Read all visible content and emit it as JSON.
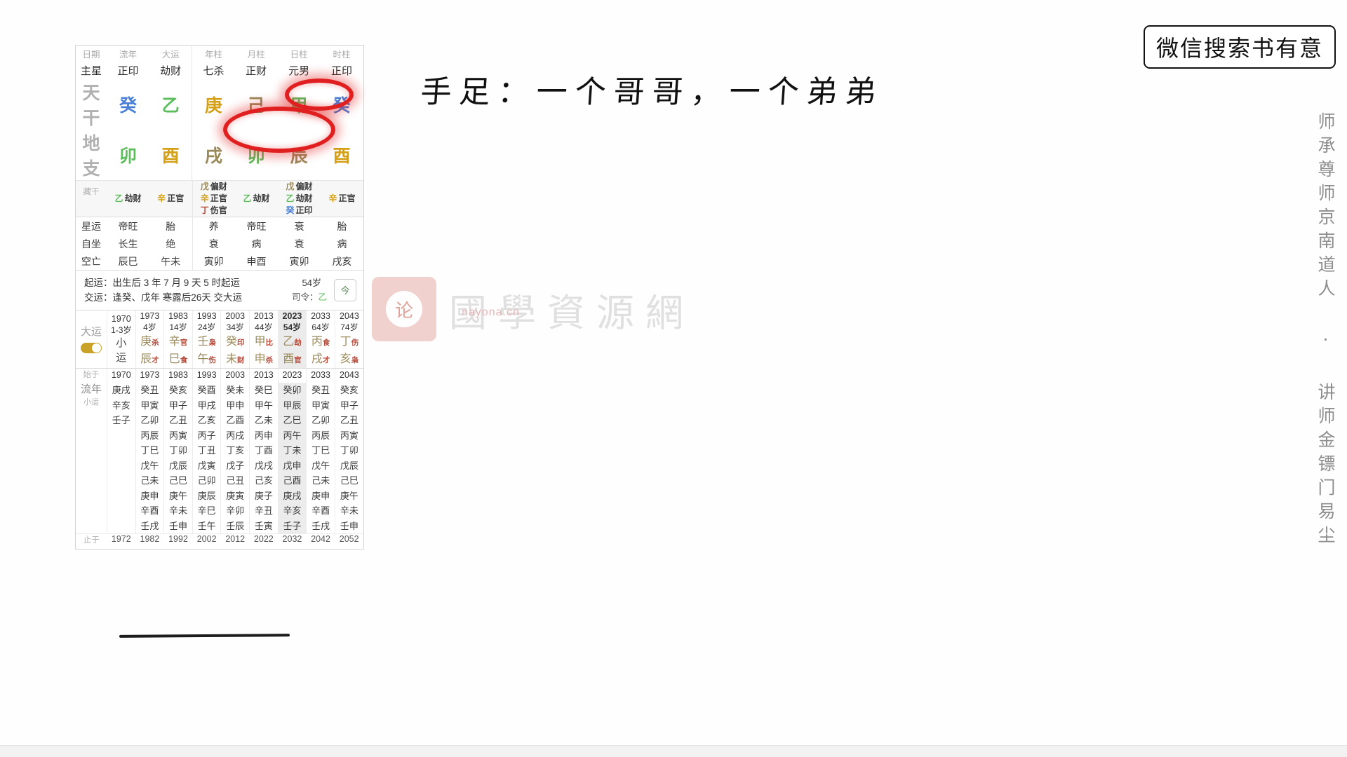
{
  "wechat_box": {
    "text": "微信搜索书有意"
  },
  "side_vertical": {
    "text": "师承尊师京南道人 · 讲师金镖门易尘"
  },
  "handwriting": {
    "text": "手足：一个哥哥，一个弟弟"
  },
  "watermark": {
    "seal_char": "论",
    "text": "國學資源網",
    "url": "nayona.cn"
  },
  "bazi": {
    "row_labels": {
      "date": "日期",
      "zhuxing": "主星",
      "tiangan": "天干",
      "dizhi": "地支",
      "canggan": "藏干",
      "xingyun": "星运",
      "zizuo": "自坐",
      "kongwang": "空亡"
    },
    "columns": [
      {
        "head": "流年",
        "zhuxing": "正印",
        "gan": "癸",
        "gan_color": "water",
        "zhi": "卯",
        "zhi_color": "wood",
        "canggan": [
          {
            "g": "乙",
            "gc": "wood",
            "t": "劫财"
          }
        ],
        "xingyun": "帝旺",
        "zizuo": "长生",
        "kongwang": "辰巳"
      },
      {
        "head": "大运",
        "zhuxing": "劫财",
        "gan": "乙",
        "gan_color": "wood",
        "zhi": "酉",
        "zhi_color": "metal",
        "canggan": [
          {
            "g": "辛",
            "gc": "metal",
            "t": "正官"
          }
        ],
        "xingyun": "胎",
        "zizuo": "绝",
        "kongwang": "午未"
      },
      {
        "head": "年柱",
        "zhuxing": "七杀",
        "gan": "庚",
        "gan_color": "metal",
        "zhi": "戌",
        "zhi_color": "earth",
        "canggan": [
          {
            "g": "戊",
            "gc": "earth",
            "t": "偏财"
          },
          {
            "g": "辛",
            "gc": "metal",
            "t": "正官"
          },
          {
            "g": "丁",
            "gc": "fire",
            "t": "伤官"
          }
        ],
        "xingyun": "养",
        "zizuo": "衰",
        "kongwang": "寅卯"
      },
      {
        "head": "月柱",
        "zhuxing": "正财",
        "gan": "己",
        "gan_color": "earth",
        "zhi": "卯",
        "zhi_color": "wood",
        "canggan": [
          {
            "g": "乙",
            "gc": "wood",
            "t": "劫财"
          }
        ],
        "xingyun": "帝旺",
        "zizuo": "病",
        "kongwang": "申酉"
      },
      {
        "head": "日柱",
        "zhuxing": "元男",
        "gan": "甲",
        "gan_color": "wood",
        "zhi": "辰",
        "zhi_color": "earth",
        "canggan": [
          {
            "g": "戊",
            "gc": "earth",
            "t": "偏财"
          },
          {
            "g": "乙",
            "gc": "wood",
            "t": "劫财"
          },
          {
            "g": "癸",
            "gc": "water",
            "t": "正印"
          }
        ],
        "xingyun": "衰",
        "zizuo": "衰",
        "kongwang": "寅卯"
      },
      {
        "head": "时柱",
        "zhuxing": "正印",
        "gan": "癸",
        "gan_color": "water",
        "zhi": "酉",
        "zhi_color": "metal",
        "canggan": [
          {
            "g": "辛",
            "gc": "metal",
            "t": "正官"
          }
        ],
        "xingyun": "胎",
        "zizuo": "病",
        "kongwang": "戌亥"
      }
    ],
    "qiyun": {
      "line1": "起运：出生后 3 年 7 月 9 天 5 时起运",
      "line2": "交运：逢癸、戊年 寒露后26天 交大运",
      "age_badge": "54岁",
      "siling_label": "司令：",
      "siling_value": "乙",
      "today_btn": "今"
    },
    "dayun": {
      "label": "大运",
      "xiaoyun_label": "小运",
      "items": [
        {
          "year": "1970",
          "age": "1-3岁",
          "gan": "",
          "gan_color": "",
          "gan_ss": "",
          "zhi": "",
          "zhi_color": "",
          "zhi_ss": "",
          "xiaoyun": true,
          "selected": false
        },
        {
          "year": "1973",
          "age": "4岁",
          "gan": "庚",
          "gan_color": "earth",
          "gan_ss": "杀",
          "zhi": "辰",
          "zhi_color": "earth",
          "zhi_ss": "才",
          "xiaoyun": false,
          "selected": false
        },
        {
          "year": "1983",
          "age": "14岁",
          "gan": "辛",
          "gan_color": "earth",
          "gan_ss": "官",
          "zhi": "巳",
          "zhi_color": "earth",
          "zhi_ss": "食",
          "xiaoyun": false,
          "selected": false
        },
        {
          "year": "1993",
          "age": "24岁",
          "gan": "壬",
          "gan_color": "earth",
          "gan_ss": "枭",
          "zhi": "午",
          "zhi_color": "earth",
          "zhi_ss": "伤",
          "xiaoyun": false,
          "selected": false
        },
        {
          "year": "2003",
          "age": "34岁",
          "gan": "癸",
          "gan_color": "earth",
          "gan_ss": "印",
          "zhi": "未",
          "zhi_color": "earth",
          "zhi_ss": "财",
          "xiaoyun": false,
          "selected": false
        },
        {
          "year": "2013",
          "age": "44岁",
          "gan": "甲",
          "gan_color": "earth",
          "gan_ss": "比",
          "zhi": "申",
          "zhi_color": "earth",
          "zhi_ss": "杀",
          "xiaoyun": false,
          "selected": false
        },
        {
          "year": "2023",
          "age": "54岁",
          "gan": "乙",
          "gan_color": "earth",
          "gan_ss": "劫",
          "zhi": "酉",
          "zhi_color": "earth",
          "zhi_ss": "官",
          "xiaoyun": false,
          "selected": true
        },
        {
          "year": "2033",
          "age": "64岁",
          "gan": "丙",
          "gan_color": "earth",
          "gan_ss": "食",
          "zhi": "戌",
          "zhi_color": "earth",
          "zhi_ss": "才",
          "xiaoyun": false,
          "selected": false
        },
        {
          "year": "2043",
          "age": "74岁",
          "gan": "丁",
          "gan_color": "earth",
          "gan_ss": "伤",
          "zhi": "亥",
          "zhi_color": "earth",
          "zhi_ss": "枭",
          "xiaoyun": false,
          "selected": false
        }
      ]
    },
    "liunian": {
      "start_label": "始于",
      "end_label": "止于",
      "side_big": "流年",
      "side_small": "小运",
      "columns": [
        {
          "start": "1970",
          "end": "1972",
          "selected": false,
          "cells": [
            "庚戌",
            "辛亥",
            "壬子",
            "",
            "",
            "",
            "",
            "",
            "",
            ""
          ]
        },
        {
          "start": "1973",
          "end": "1982",
          "selected": false,
          "cells": [
            "癸丑",
            "甲寅",
            "乙卯",
            "丙辰",
            "丁巳",
            "戊午",
            "己未",
            "庚申",
            "辛酉",
            "壬戌"
          ]
        },
        {
          "start": "1983",
          "end": "1992",
          "selected": false,
          "cells": [
            "癸亥",
            "甲子",
            "乙丑",
            "丙寅",
            "丁卯",
            "戊辰",
            "己巳",
            "庚午",
            "辛未",
            "壬申"
          ]
        },
        {
          "start": "1993",
          "end": "2002",
          "selected": false,
          "cells": [
            "癸酉",
            "甲戌",
            "乙亥",
            "丙子",
            "丁丑",
            "戊寅",
            "己卯",
            "庚辰",
            "辛巳",
            "壬午"
          ]
        },
        {
          "start": "2003",
          "end": "2012",
          "selected": false,
          "cells": [
            "癸未",
            "甲申",
            "乙酉",
            "丙戌",
            "丁亥",
            "戊子",
            "己丑",
            "庚寅",
            "辛卯",
            "壬辰"
          ]
        },
        {
          "start": "2013",
          "end": "2022",
          "selected": false,
          "cells": [
            "癸巳",
            "甲午",
            "乙未",
            "丙申",
            "丁酉",
            "戊戌",
            "己亥",
            "庚子",
            "辛丑",
            "壬寅"
          ]
        },
        {
          "start": "2023",
          "end": "2032",
          "selected": true,
          "cells": [
            "癸卯",
            "甲辰",
            "乙巳",
            "丙午",
            "丁未",
            "戊申",
            "己酉",
            "庚戌",
            "辛亥",
            "壬子"
          ]
        },
        {
          "start": "2033",
          "end": "2042",
          "selected": false,
          "cells": [
            "癸丑",
            "甲寅",
            "乙卯",
            "丙辰",
            "丁巳",
            "戊午",
            "己未",
            "庚申",
            "辛酉",
            "壬戌"
          ]
        },
        {
          "start": "2043",
          "end": "2052",
          "selected": false,
          "cells": [
            "癸亥",
            "甲子",
            "乙丑",
            "丙寅",
            "丁卯",
            "戊辰",
            "己巳",
            "庚午",
            "辛未",
            "壬申"
          ]
        }
      ]
    }
  },
  "annotations": {
    "oval_large": "red-circle-around-month-day-branch",
    "oval_small": "red-circle-around-hour-stem"
  }
}
